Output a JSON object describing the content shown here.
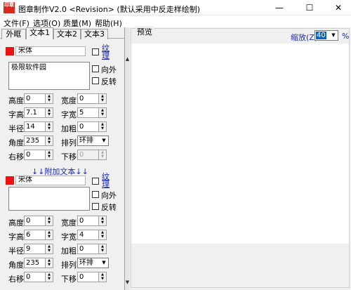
{
  "window": {
    "icon_text": "印章",
    "title": "图章制作V2.0 <Revision> (默认采用中反走样绘制)",
    "minimize": "—",
    "maximize": "☐",
    "close": "✕"
  },
  "menu": [
    "文件(F)",
    "选项(O)",
    "质量(M)",
    "帮助(H)"
  ],
  "tabs": [
    "外眶",
    "文本1",
    "文本2",
    "文本3"
  ],
  "scroll": {
    "up": "▲",
    "down": "▼"
  },
  "text1": {
    "font": "宋体",
    "texture": "纹理",
    "content": "极限软件园",
    "outward": "向外",
    "reverse": "反转",
    "fields": {
      "height": {
        "label": "高度",
        "value": "0"
      },
      "width": {
        "label": "宽度",
        "value": "0"
      },
      "char_height": {
        "label": "字高",
        "value": "7.1"
      },
      "char_width": {
        "label": "字宽",
        "value": "5"
      },
      "radius": {
        "label": "半径",
        "value": "14"
      },
      "bold": {
        "label": "加粗",
        "value": "0"
      },
      "angle": {
        "label": "角度",
        "value": "235"
      },
      "arrange": {
        "label": "排列",
        "value": "环排"
      },
      "shift_right": {
        "label": "右移",
        "value": "0"
      },
      "shift_down": {
        "label": "下移",
        "value": "0"
      }
    }
  },
  "extra_heading": "↓↓附加文本↓↓",
  "extra": {
    "font": "宋体",
    "texture": "纹理",
    "content": "",
    "outward": "向外",
    "reverse": "反转",
    "fields": {
      "height": {
        "label": "高度",
        "value": "0"
      },
      "width": {
        "label": "宽度",
        "value": "0"
      },
      "char_height": {
        "label": "字高",
        "value": "6"
      },
      "char_width": {
        "label": "字宽",
        "value": "4"
      },
      "radius": {
        "label": "半径",
        "value": "9"
      },
      "bold": {
        "label": "加粗",
        "value": "0"
      },
      "angle": {
        "label": "角度",
        "value": "235"
      },
      "arrange": {
        "label": "排列",
        "value": "环排"
      },
      "shift_right": {
        "label": "右移",
        "value": "0"
      },
      "shift_down": {
        "label": "下移",
        "value": "0"
      }
    }
  },
  "preview": {
    "title": "预览",
    "zoom_label": "缩放(Z)",
    "zoom_value": "40",
    "zoom_unit": "%"
  },
  "colors": {
    "swatch": "#ee1111",
    "accent": "#1c2bb4"
  },
  "icons": {
    "spin": "spinner-arrows",
    "dropdown": "chevron-down-icon"
  }
}
